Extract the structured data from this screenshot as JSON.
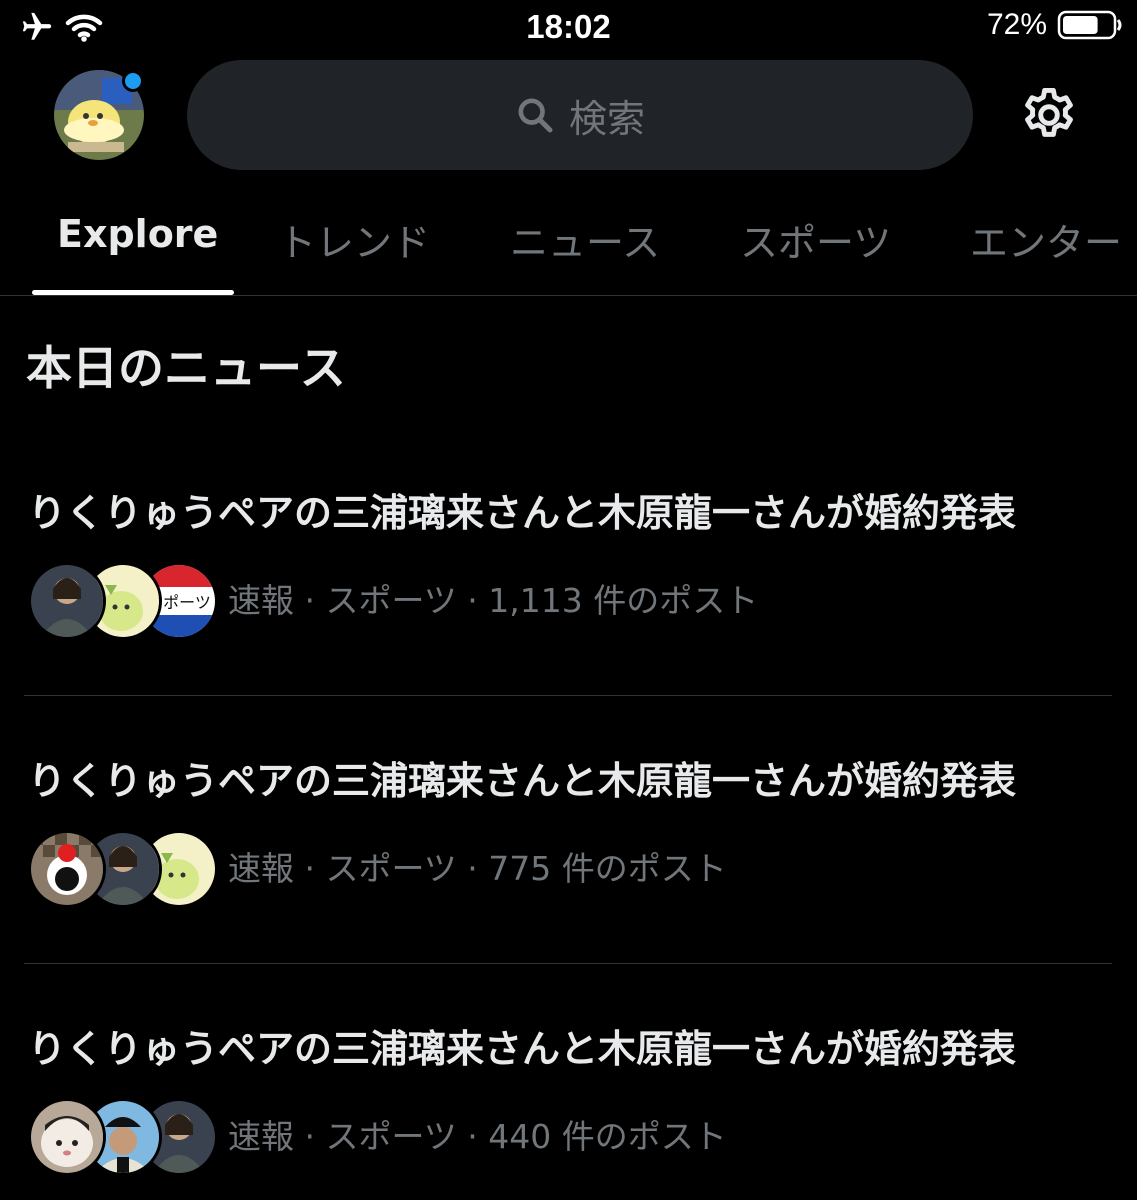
{
  "status_bar": {
    "time": "18:02",
    "battery_percent": "72%",
    "battery_level": 0.72,
    "icons": [
      "airplane-icon",
      "wifi-icon",
      "battery-icon"
    ]
  },
  "header": {
    "search_placeholder": "検索",
    "notification_dot_color": "#1d9bf0"
  },
  "tabs": [
    {
      "label": "Explore",
      "active": true
    },
    {
      "label": "トレンド",
      "active": false
    },
    {
      "label": "ニュース",
      "active": false
    },
    {
      "label": "スポーツ",
      "active": false
    },
    {
      "label": "エンター",
      "active": false
    }
  ],
  "section_title": "本日のニュース",
  "news": [
    {
      "title": "りくりゅうペアの三浦璃来さんと木原龍一さんが婚約発表",
      "meta": "速報 · スポーツ · 1,113 件のポスト"
    },
    {
      "title": "りくりゅうペアの三浦璃来さんと木原龍一さんが婚約発表",
      "meta": "速報 · スポーツ · 775 件のポスト"
    },
    {
      "title": "りくりゅうペアの三浦璃来さんと木原龍一さんが婚約発表",
      "meta": "速報 · スポーツ · 440 件のポスト"
    }
  ],
  "colors": {
    "background": "#000000",
    "primary_text": "#e7e9ea",
    "secondary_text": "#71767b",
    "accent": "#1d9bf0",
    "search_bg": "#202327"
  }
}
